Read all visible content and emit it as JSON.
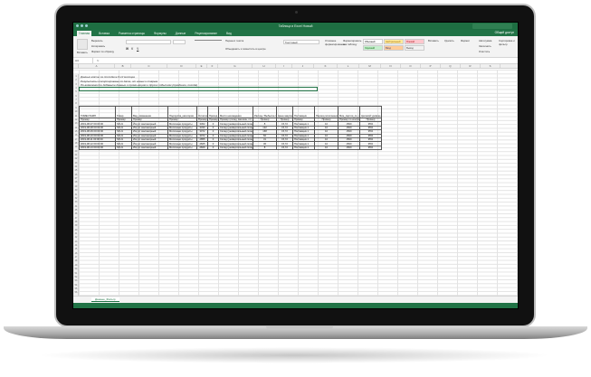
{
  "window": {
    "title": "Таблица в Excel Новый"
  },
  "tabs": [
    "Главная",
    "Вставка",
    "Разметка страницы",
    "Формулы",
    "Данные",
    "Рецензирование",
    "Вид"
  ],
  "share_label": "Общий доступ",
  "ribbon": {
    "insert_label": "Вставить",
    "cut_label": "Вырезать",
    "copy_label": "Копировать",
    "format_painter_label": "Формат по образцу",
    "wrap_label": "Перенос текста",
    "merge_label": "Объединить и поместить в центре",
    "number_format": "Текстовый",
    "conditional_label": "Условное форматирование",
    "format_as_table_label": "Форматировать как таблицу",
    "styles": [
      {
        "label": "Обычный",
        "bg": "#ffffff",
        "fg": "#000000"
      },
      {
        "label": "Нейтральный",
        "bg": "#ffeb9c",
        "fg": "#9c6500"
      },
      {
        "label": "Плохой",
        "bg": "#ffc7ce",
        "fg": "#9c0006"
      },
      {
        "label": "Хороший",
        "bg": "#c6efce",
        "fg": "#006100"
      },
      {
        "label": "Ввод",
        "bg": "#ffcc99",
        "fg": "#3f3f76"
      },
      {
        "label": "Вывод",
        "bg": "#f2f2f2",
        "fg": "#3f3f3f"
      }
    ],
    "insert_cells_label": "Вставить",
    "delete_cells_label": "Удалить",
    "format_cells_label": "Формат",
    "autosum_label": "Автосумма",
    "fill_label": "Заполнить",
    "clear_label": "Очистить",
    "sort_label": "Сортировка и фильтр"
  },
  "formula_bar": {
    "name_box": "A4",
    "fx": "fx"
  },
  "columns": [
    "A",
    "B",
    "C",
    "D",
    "E",
    "F",
    "G",
    "H",
    "I",
    "J",
    "K",
    "L",
    "M",
    "N",
    "O",
    "P",
    "Q",
    "R",
    "S"
  ],
  "rows": [
    "1",
    "2",
    "3",
    "4",
    "5",
    "6",
    "7",
    "8",
    "9",
    "10",
    "11",
    "12",
    "13",
    "14",
    "15",
    "16",
    "17",
    "18",
    "19",
    "20",
    "21",
    "22",
    "23",
    "24",
    "25",
    "26",
    "27",
    "28",
    "29",
    "30",
    "31",
    "32",
    "33",
    "34",
    "35",
    "36",
    "37",
    "38",
    "39",
    "40",
    "41",
    "42",
    "43",
    "44",
    "45",
    "46",
    "47",
    "48",
    "49",
    "50",
    "51",
    "52",
    "53",
    "54",
    "55",
    "56"
  ],
  "text_lines": [
    "Данные взяты за последние 6-12 месяцев",
    "Результаты отсортированы по дате, от новых к старым",
    "По возможности добавьте данные о промо-акциях и других событиях (праздники, погода)"
  ],
  "table": {
    "headers": [
      "ТИМЕСТАМП",
      "Товар",
      "Вид_изменения",
      "Подгруппа_категория",
      "Остаток_шт",
      "Приход в шт-ах",
      "Место нахождения",
      "Расход / Выбытие / потребление в шт-ах",
      "Цена закупки_руб",
      "Поставщик",
      "Период пополнения (зарезервирован)",
      "Мин_партия_по_ставке_шт",
      "Целевой уровень сервиса"
    ],
    "example": [
      "Пример",
      "Пример",
      "Пример",
      "Пример",
      "Пример",
      "Пример",
      "Пример (склад, магазин, пт)",
      "Пример",
      "Пример",
      "Пример",
      "Пример",
      "Пример по контракту",
      "Пример"
    ],
    "rows": [
      [
        "2019-08-07 00:00:00",
        "SKU1",
        "Йогурт маложирный",
        "Молочные продукты",
        "3362",
        "0",
        "Склад (универсальный склад)",
        "8",
        "15,72",
        "Поставщик 1",
        "10",
        "1500",
        "95%"
      ],
      [
        "2019-08-08 00:00:00",
        "SKU1",
        "Йогурт маложирный",
        "Молочные продукты",
        "3330",
        "0",
        "Склад (универсальный склад)",
        "122",
        "15,72",
        "Поставщик 1",
        "10",
        "1500",
        "95%"
      ],
      [
        "2019-08-09 00:00:00",
        "SKU1",
        "Йогурт маложирный",
        "Молочные продукты",
        "3072",
        "0",
        "Склад (универсальный склад)",
        "168",
        "15,72",
        "Поставщик 1",
        "10",
        "1500",
        "95%"
      ],
      [
        "2019-08-10 00:00:00",
        "SKU1",
        "Йогурт маложирный",
        "Молочные продукты",
        "3072",
        "0",
        "Склад (универсальный склад)",
        "82",
        "15,72",
        "Поставщик 1",
        "10",
        "1500",
        "95%"
      ],
      [
        "2019-08-11 00:00:00",
        "SKU1",
        "Йогурт маложирный",
        "Молочные продукты",
        "2855",
        "0",
        "Склад (универсальный склад)",
        "31",
        "15,72",
        "Поставщик 1",
        "10",
        "1500",
        "95%"
      ],
      [
        "2019-08-12 00:00:00",
        "SKU1",
        "Йогурт маложирный",
        "Молочные продукты",
        "2825",
        "0",
        "Склад (универсальный склад)",
        "36",
        "15,72",
        "Поставщик 1",
        "10",
        "1500",
        "95%"
      ],
      [
        "2019-08-13 00:00:00",
        "SKU1",
        "Йогурт маложирный",
        "Молочные продукты",
        "2829",
        "0",
        "Склад (универсальный склад)",
        "8",
        "15,72",
        "Поставщик 1",
        "10",
        "1500",
        "95%"
      ]
    ]
  },
  "sheet_tab": "Данные_Фильтр"
}
